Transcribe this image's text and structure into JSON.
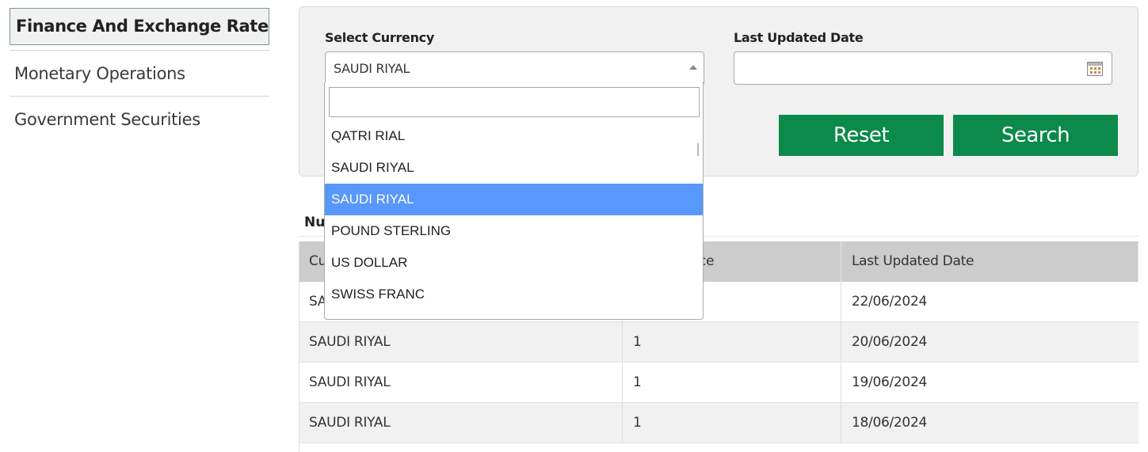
{
  "sidebar": {
    "items": [
      {
        "label": "Finance And Exchange Rate",
        "active": true
      },
      {
        "label": "Monetary Operations"
      },
      {
        "label": "Government Securities"
      }
    ]
  },
  "filters": {
    "currency_label": "Select Currency",
    "currency_value": "SAUDI RIYAL",
    "date_label": "Last Updated Date",
    "date_value": "",
    "reset_label": "Reset",
    "search_label": "Search"
  },
  "dropdown": {
    "search_value": "",
    "options": [
      "QATRI RIAL",
      "SAUDI RIYAL",
      "SAUDI RIYAL",
      "POUND STERLING",
      "US DOLLAR",
      "SWISS FRANC"
    ],
    "highlighted_index": 2
  },
  "results": {
    "heading": "Nu",
    "columns": [
      "Cu",
      "ce",
      "Last Updated Date"
    ],
    "rows": [
      [
        "SA",
        "",
        "22/06/2024"
      ],
      [
        "SAUDI RIYAL",
        "1",
        "20/06/2024"
      ],
      [
        "SAUDI RIYAL",
        "1",
        "19/06/2024"
      ],
      [
        "SAUDI RIYAL",
        "1",
        "18/06/2024"
      ]
    ]
  },
  "colors": {
    "accent": "#0b8a4a",
    "highlight": "#5897fb",
    "panel": "#f1f1f1",
    "table_header": "#cccccc"
  }
}
